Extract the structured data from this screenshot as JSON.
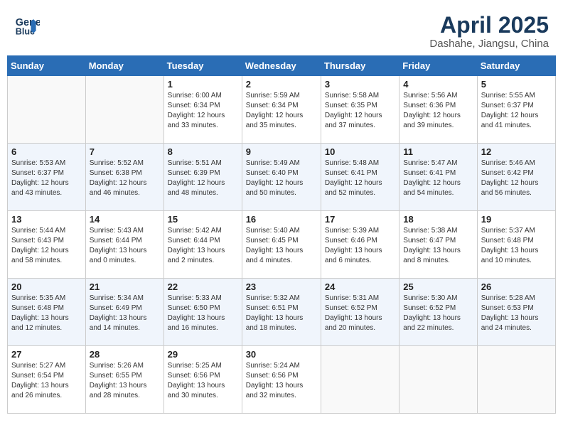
{
  "header": {
    "logo_line1": "General",
    "logo_line2": "Blue",
    "month_title": "April 2025",
    "location": "Dashahe, Jiangsu, China"
  },
  "days_of_week": [
    "Sunday",
    "Monday",
    "Tuesday",
    "Wednesday",
    "Thursday",
    "Friday",
    "Saturday"
  ],
  "weeks": [
    [
      {
        "day": "",
        "info": ""
      },
      {
        "day": "",
        "info": ""
      },
      {
        "day": "1",
        "info": "Sunrise: 6:00 AM\nSunset: 6:34 PM\nDaylight: 12 hours\nand 33 minutes."
      },
      {
        "day": "2",
        "info": "Sunrise: 5:59 AM\nSunset: 6:34 PM\nDaylight: 12 hours\nand 35 minutes."
      },
      {
        "day": "3",
        "info": "Sunrise: 5:58 AM\nSunset: 6:35 PM\nDaylight: 12 hours\nand 37 minutes."
      },
      {
        "day": "4",
        "info": "Sunrise: 5:56 AM\nSunset: 6:36 PM\nDaylight: 12 hours\nand 39 minutes."
      },
      {
        "day": "5",
        "info": "Sunrise: 5:55 AM\nSunset: 6:37 PM\nDaylight: 12 hours\nand 41 minutes."
      }
    ],
    [
      {
        "day": "6",
        "info": "Sunrise: 5:53 AM\nSunset: 6:37 PM\nDaylight: 12 hours\nand 43 minutes."
      },
      {
        "day": "7",
        "info": "Sunrise: 5:52 AM\nSunset: 6:38 PM\nDaylight: 12 hours\nand 46 minutes."
      },
      {
        "day": "8",
        "info": "Sunrise: 5:51 AM\nSunset: 6:39 PM\nDaylight: 12 hours\nand 48 minutes."
      },
      {
        "day": "9",
        "info": "Sunrise: 5:49 AM\nSunset: 6:40 PM\nDaylight: 12 hours\nand 50 minutes."
      },
      {
        "day": "10",
        "info": "Sunrise: 5:48 AM\nSunset: 6:41 PM\nDaylight: 12 hours\nand 52 minutes."
      },
      {
        "day": "11",
        "info": "Sunrise: 5:47 AM\nSunset: 6:41 PM\nDaylight: 12 hours\nand 54 minutes."
      },
      {
        "day": "12",
        "info": "Sunrise: 5:46 AM\nSunset: 6:42 PM\nDaylight: 12 hours\nand 56 minutes."
      }
    ],
    [
      {
        "day": "13",
        "info": "Sunrise: 5:44 AM\nSunset: 6:43 PM\nDaylight: 12 hours\nand 58 minutes."
      },
      {
        "day": "14",
        "info": "Sunrise: 5:43 AM\nSunset: 6:44 PM\nDaylight: 13 hours\nand 0 minutes."
      },
      {
        "day": "15",
        "info": "Sunrise: 5:42 AM\nSunset: 6:44 PM\nDaylight: 13 hours\nand 2 minutes."
      },
      {
        "day": "16",
        "info": "Sunrise: 5:40 AM\nSunset: 6:45 PM\nDaylight: 13 hours\nand 4 minutes."
      },
      {
        "day": "17",
        "info": "Sunrise: 5:39 AM\nSunset: 6:46 PM\nDaylight: 13 hours\nand 6 minutes."
      },
      {
        "day": "18",
        "info": "Sunrise: 5:38 AM\nSunset: 6:47 PM\nDaylight: 13 hours\nand 8 minutes."
      },
      {
        "day": "19",
        "info": "Sunrise: 5:37 AM\nSunset: 6:48 PM\nDaylight: 13 hours\nand 10 minutes."
      }
    ],
    [
      {
        "day": "20",
        "info": "Sunrise: 5:35 AM\nSunset: 6:48 PM\nDaylight: 13 hours\nand 12 minutes."
      },
      {
        "day": "21",
        "info": "Sunrise: 5:34 AM\nSunset: 6:49 PM\nDaylight: 13 hours\nand 14 minutes."
      },
      {
        "day": "22",
        "info": "Sunrise: 5:33 AM\nSunset: 6:50 PM\nDaylight: 13 hours\nand 16 minutes."
      },
      {
        "day": "23",
        "info": "Sunrise: 5:32 AM\nSunset: 6:51 PM\nDaylight: 13 hours\nand 18 minutes."
      },
      {
        "day": "24",
        "info": "Sunrise: 5:31 AM\nSunset: 6:52 PM\nDaylight: 13 hours\nand 20 minutes."
      },
      {
        "day": "25",
        "info": "Sunrise: 5:30 AM\nSunset: 6:52 PM\nDaylight: 13 hours\nand 22 minutes."
      },
      {
        "day": "26",
        "info": "Sunrise: 5:28 AM\nSunset: 6:53 PM\nDaylight: 13 hours\nand 24 minutes."
      }
    ],
    [
      {
        "day": "27",
        "info": "Sunrise: 5:27 AM\nSunset: 6:54 PM\nDaylight: 13 hours\nand 26 minutes."
      },
      {
        "day": "28",
        "info": "Sunrise: 5:26 AM\nSunset: 6:55 PM\nDaylight: 13 hours\nand 28 minutes."
      },
      {
        "day": "29",
        "info": "Sunrise: 5:25 AM\nSunset: 6:56 PM\nDaylight: 13 hours\nand 30 minutes."
      },
      {
        "day": "30",
        "info": "Sunrise: 5:24 AM\nSunset: 6:56 PM\nDaylight: 13 hours\nand 32 minutes."
      },
      {
        "day": "",
        "info": ""
      },
      {
        "day": "",
        "info": ""
      },
      {
        "day": "",
        "info": ""
      }
    ]
  ]
}
